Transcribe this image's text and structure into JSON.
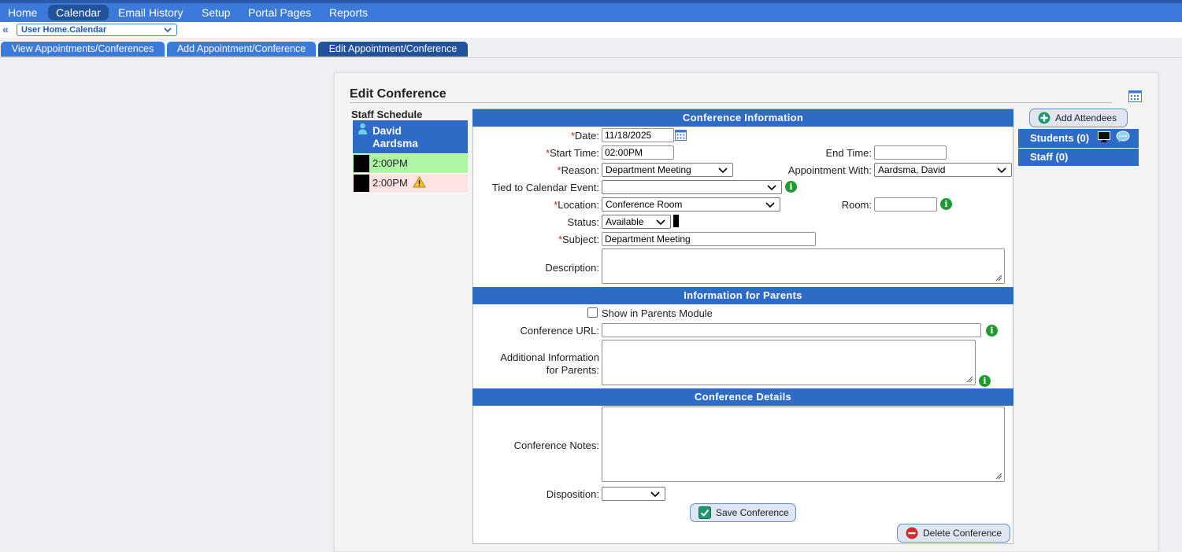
{
  "nav": {
    "items": [
      "Home",
      "Calendar",
      "Email History",
      "Setup",
      "Portal Pages",
      "Reports"
    ],
    "active": "Calendar"
  },
  "breadcrumb": {
    "back_icon": "double-chevron-left-icon",
    "selected": "User Home.Calendar"
  },
  "tabs": [
    "View Appointments/Conferences",
    "Add Appointment/Conference",
    "Edit Appointment/Conference"
  ],
  "page": {
    "title": "Edit Conference"
  },
  "staff_schedule": {
    "title": "Staff Schedule",
    "name_line1": "David",
    "name_line2": "Aardsma",
    "slots": [
      {
        "time": "2:00PM",
        "color": "#aef5a6",
        "warning": false
      },
      {
        "time": "2:00PM",
        "color": "#fde3e3",
        "warning": true
      }
    ]
  },
  "sections": {
    "conference_info": "Conference Information",
    "parents_info": "Information for Parents",
    "conference_details": "Conference Details"
  },
  "form": {
    "required_mark": "*",
    "date": {
      "label": "Date:",
      "value": "11/18/2025"
    },
    "start_time": {
      "label": "Start Time:",
      "value": "02:00PM"
    },
    "end_time": {
      "label": "End Time:",
      "value": ""
    },
    "reason": {
      "label": "Reason:",
      "value": "Department Meeting"
    },
    "appointment_with": {
      "label": "Appointment With:",
      "value": "Aardsma, David"
    },
    "tied_event": {
      "label": "Tied to Calendar Event:",
      "value": ""
    },
    "location": {
      "label": "Location:",
      "value": "Conference Room"
    },
    "room": {
      "label": "Room:",
      "value": ""
    },
    "status": {
      "label": "Status:",
      "value": "Available"
    },
    "subject": {
      "label": "Subject:",
      "value": "Department Meeting"
    },
    "description": {
      "label": "Description:",
      "value": ""
    },
    "show_in_parents": {
      "label": "Show in Parents Module",
      "checked": false
    },
    "conference_url": {
      "label": "Conference URL:",
      "value": ""
    },
    "additional_info": {
      "label_line1": "Additional Information",
      "label_line2": "for Parents:",
      "value": ""
    },
    "conference_notes": {
      "label": "Conference Notes:",
      "value": ""
    },
    "disposition": {
      "label": "Disposition:",
      "value": ""
    }
  },
  "buttons": {
    "save": "Save Conference",
    "delete": "Delete Conference",
    "add_attendees": "Add Attendees"
  },
  "attendees": {
    "students": "Students (0)",
    "staff": "Staff (0)"
  },
  "colors": {
    "nav_bg": "#3b7ad8",
    "nav_active": "#22529c",
    "section_head": "#2e6bc7",
    "info_icon": "#1f9a2e",
    "required": "#d02020"
  }
}
